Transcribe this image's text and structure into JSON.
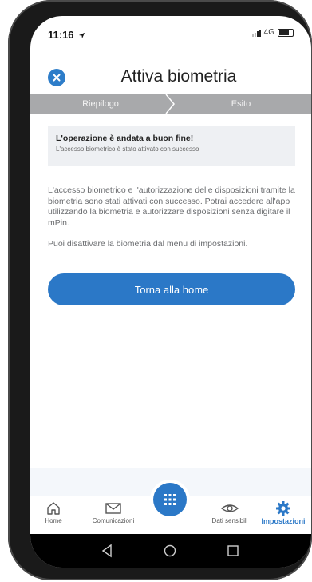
{
  "status_bar": {
    "time": "11:16",
    "network": "4G"
  },
  "header": {
    "title": "Attiva biometria"
  },
  "stepper": {
    "steps": [
      "Riepilogo",
      "Esito"
    ]
  },
  "success": {
    "title": "L'operazione è andata a buon fine!",
    "subtitle": "L'accesso biometrico è stato attivato con successo"
  },
  "body": {
    "paragraph1": "L'accesso biometrico e l'autorizzazione delle disposizioni tramite la biometria sono stati attivati con successo. Potrai accedere all'app utilizzando la biometria e autorizzare disposizioni senza digitare il mPin.",
    "paragraph2": "Puoi disattivare la biometria dal menu di impostazioni."
  },
  "actions": {
    "home_button": "Torna alla home"
  },
  "tabbar": {
    "items": [
      {
        "label": "Home",
        "icon": "home-icon"
      },
      {
        "label": "Comunicazioni",
        "icon": "mail-icon"
      },
      {
        "label": "",
        "icon": "grid-icon"
      },
      {
        "label": "Dati sensibili",
        "icon": "eye-icon"
      },
      {
        "label": "Impostazioni",
        "icon": "gear-icon",
        "active": true
      }
    ]
  },
  "colors": {
    "accent": "#2b78c7",
    "stepper_bg": "#a8a9ab",
    "success_bg": "#eef0f3"
  }
}
